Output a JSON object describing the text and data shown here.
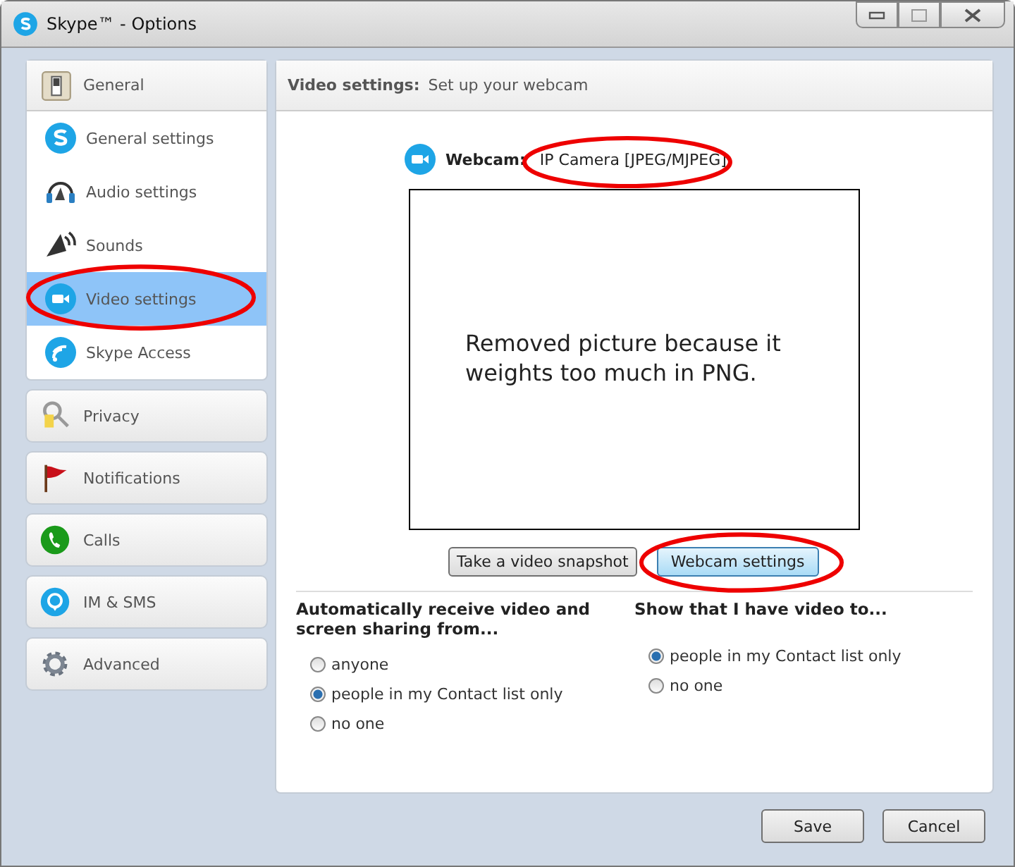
{
  "window": {
    "title": "Skype™ - Options"
  },
  "sidebar": {
    "general": {
      "label": "General",
      "items": [
        {
          "label": "General settings",
          "selected": false,
          "circled": false
        },
        {
          "label": "Audio settings",
          "selected": false,
          "circled": false
        },
        {
          "label": "Sounds",
          "selected": false,
          "circled": false
        },
        {
          "label": "Video settings",
          "selected": true,
          "circled": true
        },
        {
          "label": "Skype Access",
          "selected": false,
          "circled": false
        }
      ]
    },
    "sections": [
      {
        "label": "Privacy"
      },
      {
        "label": "Notifications"
      },
      {
        "label": "Calls"
      },
      {
        "label": "IM & SMS"
      },
      {
        "label": "Advanced"
      }
    ]
  },
  "content": {
    "title": "Video settings:",
    "subtitle": "Set up your webcam",
    "webcam": {
      "label": "Webcam:",
      "value": "IP Camera [JPEG/MJPEG]",
      "circled": true
    },
    "preview_text": "Removed picture because it weights too much in PNG.",
    "buttons": [
      {
        "label": "Take a video snapshot",
        "primary": false,
        "circled": false
      },
      {
        "label": "Webcam settings",
        "primary": true,
        "circled": true
      }
    ],
    "groups": [
      {
        "title": "Automatically receive video and screen sharing from...",
        "options": [
          {
            "label": "anyone",
            "selected": false
          },
          {
            "label": "people in my Contact list only",
            "selected": true
          },
          {
            "label": "no one",
            "selected": false
          }
        ]
      },
      {
        "title": "Show that I have video to...",
        "options": [
          {
            "label": "people in my Contact list only",
            "selected": true
          },
          {
            "label": "no one",
            "selected": false
          }
        ]
      }
    ]
  },
  "footer": {
    "buttons": [
      "Save",
      "Cancel"
    ]
  }
}
